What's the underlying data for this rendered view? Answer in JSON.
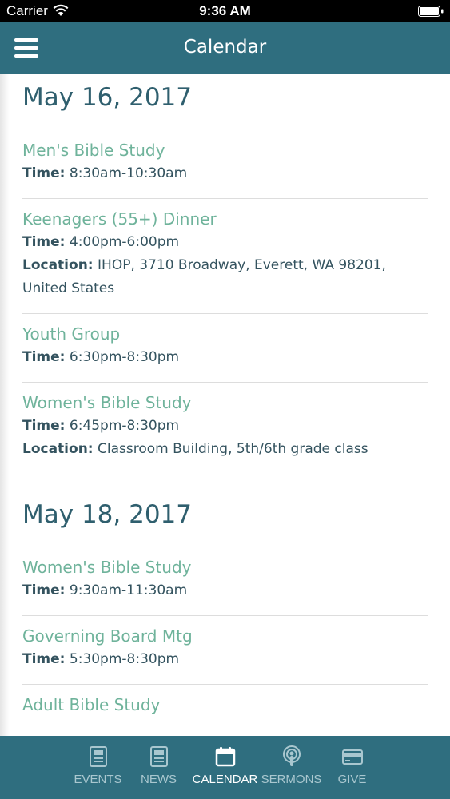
{
  "status_bar": {
    "carrier": "Carrier",
    "time": "9:36 AM"
  },
  "header": {
    "title": "Calendar"
  },
  "days": [
    {
      "date": "May 16, 2017",
      "events": [
        {
          "title": "Men's Bible Study",
          "time_label": "Time:",
          "time": "8:30am-10:30am"
        },
        {
          "title": "Keenagers (55+) Dinner",
          "time_label": "Time:",
          "time": "4:00pm-6:00pm",
          "location_label": "Location:",
          "location": "IHOP, 3710 Broadway, Everett, WA 98201, United States"
        },
        {
          "title": "Youth Group",
          "time_label": "Time:",
          "time": "6:30pm-8:30pm"
        },
        {
          "title": "Women's Bible Study",
          "time_label": "Time:",
          "time": "6:45pm-8:30pm",
          "location_label": "Location:",
          "location": "Classroom Building, 5th/6th grade class"
        }
      ]
    },
    {
      "date": "May 18, 2017",
      "events": [
        {
          "title": "Women's Bible Study",
          "time_label": "Time:",
          "time": "9:30am-11:30am"
        },
        {
          "title": "Governing Board Mtg",
          "time_label": "Time:",
          "time": "5:30pm-8:30pm"
        },
        {
          "title": "Adult Bible Study"
        }
      ]
    }
  ],
  "tabs": [
    {
      "label": "EVENTS",
      "icon": "events-icon"
    },
    {
      "label": "NEWS",
      "icon": "news-icon"
    },
    {
      "label": "CALENDAR",
      "icon": "calendar-icon",
      "active": true
    },
    {
      "label": "SERMONS",
      "icon": "podcast-icon"
    },
    {
      "label": "GIVE",
      "icon": "credit-card-icon"
    }
  ],
  "colors": {
    "brand": "#2f6e7f",
    "event_title": "#6fb39b",
    "heading": "#2f5f6e",
    "tab_inactive": "#a9c7cf"
  }
}
